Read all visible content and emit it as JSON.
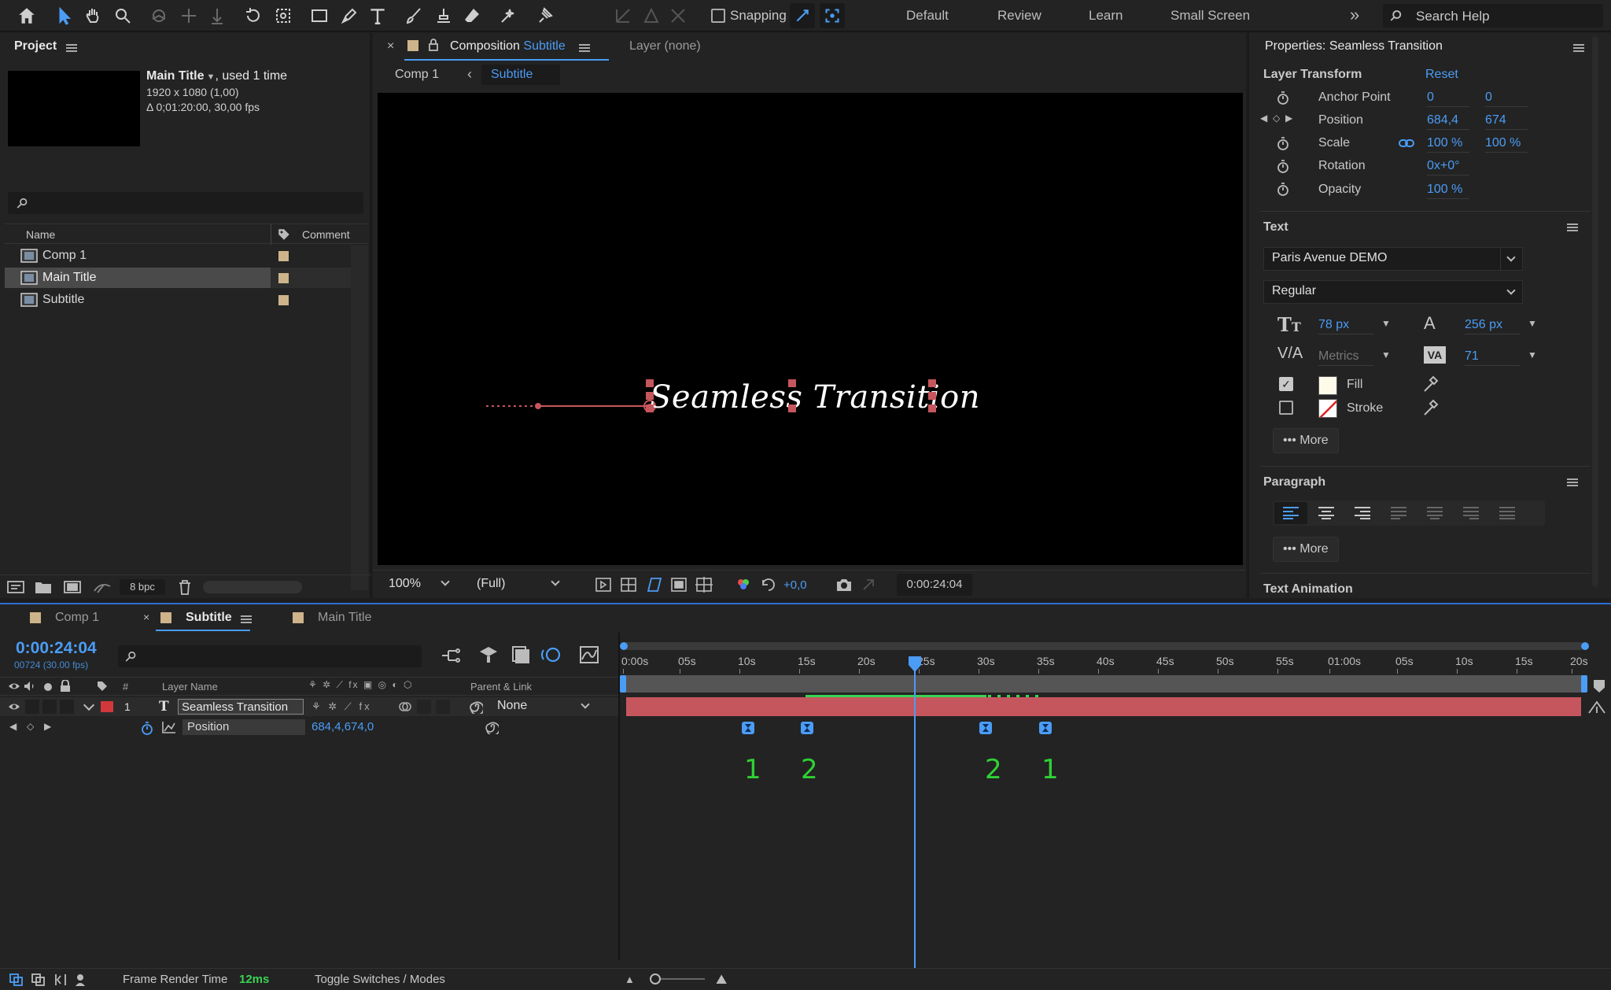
{
  "toolbar": {
    "snapping_label": "Snapping",
    "workspaces": [
      "Default",
      "Review",
      "Learn",
      "Small Screen"
    ],
    "search_placeholder": "Search Help"
  },
  "project": {
    "title": "Project",
    "selected_name": "Main Title",
    "used": ", used 1 time",
    "resolution": "1920 x 1080 (1,00)",
    "duration": "Δ 0;01:20:00, 30,00 fps",
    "col_name": "Name",
    "col_comment": "Comment",
    "items": [
      "Comp 1",
      "Main Title",
      "Subtitle"
    ],
    "bpc": "8 bpc"
  },
  "composition": {
    "tab_prefix": "Composition",
    "tab_name": "Subtitle",
    "layer_tab": "Layer (none)",
    "breadcrumb_comp1": "Comp 1",
    "breadcrumb_subtitle": "Subtitle",
    "canvas_text": "Seamless Transition",
    "zoom": "100%",
    "resolution": "(Full)",
    "exposure": "+0,0",
    "timecode": "0:00:24:04"
  },
  "properties": {
    "title": "Properties: Seamless Transition",
    "layer_transform": "Layer Transform",
    "reset": "Reset",
    "rows": [
      {
        "label": "Anchor Point",
        "v1": "0",
        "v2": "0"
      },
      {
        "label": "Position",
        "v1": "684,4",
        "v2": "674"
      },
      {
        "label": "Scale",
        "v1": "100 %",
        "v2": "100 %"
      },
      {
        "label": "Rotation",
        "v1": "0x+0°",
        "v2": ""
      },
      {
        "label": "Opacity",
        "v1": "100 %",
        "v2": ""
      }
    ],
    "text_section": "Text",
    "font": "Paris Avenue DEMO",
    "style": "Regular",
    "size": "78 px",
    "leading": "256 px",
    "kerning": "Metrics",
    "tracking": "71",
    "fill": "Fill",
    "stroke": "Stroke",
    "more": "More",
    "paragraph": "Paragraph",
    "text_animation": "Text Animation"
  },
  "timeline": {
    "tabs": [
      "Comp 1",
      "Subtitle",
      "Main Title"
    ],
    "timecode": "0:00:24:04",
    "frames": "00724 (30.00 fps)",
    "col_layer_name": "Layer Name",
    "col_parent": "Parent & Link",
    "layer_number": "1",
    "layer_name": "Seamless Transition",
    "parent": "None",
    "property_name": "Position",
    "property_value": "684,4,674,0",
    "ruler": [
      "0:00s",
      "05s",
      "10s",
      "15s",
      "20s",
      "25s",
      "30s",
      "35s",
      "40s",
      "45s",
      "50s",
      "55s",
      "01:00s",
      "05s",
      "10s",
      "15s",
      "20s"
    ],
    "keyframe_labels": [
      "1",
      "2",
      "2",
      "1"
    ],
    "footer_render_label": "Frame Render Time",
    "footer_render_value": "12ms",
    "footer_toggle": "Toggle Switches / Modes"
  },
  "colors": {
    "accent": "#4b9cf5",
    "layer_bar": "#c6565d",
    "label_red": "#d0383b",
    "work_green": "#39d353"
  }
}
